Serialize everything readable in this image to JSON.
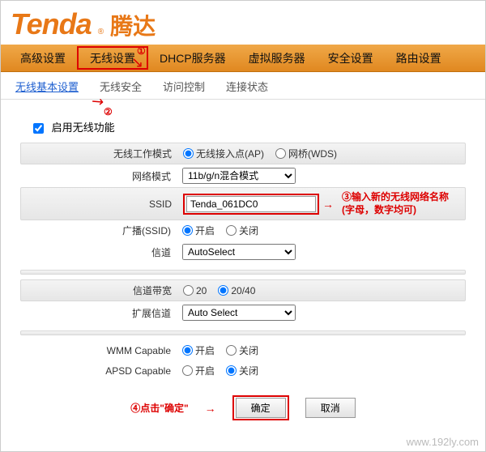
{
  "logo": {
    "brand": "Tenda",
    "reg": "®",
    "cn": "腾达"
  },
  "mainNav": [
    "高级设置",
    "无线设置",
    "DHCP服务器",
    "虚拟服务器",
    "安全设置",
    "路由设置"
  ],
  "subNav": [
    "无线基本设置",
    "无线安全",
    "访问控制",
    "连接状态"
  ],
  "enableLabel": "启用无线功能",
  "rows": {
    "workMode": {
      "label": "无线工作模式",
      "opt1": "无线接入点(AP)",
      "opt2": "网桥(WDS)"
    },
    "netMode": {
      "label": "网络模式",
      "value": "11b/g/n混合模式"
    },
    "ssid": {
      "label": "SSID",
      "value": "Tenda_061DC0"
    },
    "broadcast": {
      "label": "广播(SSID)",
      "opt1": "开启",
      "opt2": "关闭"
    },
    "channel": {
      "label": "信道",
      "value": "AutoSelect"
    },
    "bandwidth": {
      "label": "信道带宽",
      "opt1": "20",
      "opt2": "20/40"
    },
    "extChannel": {
      "label": "扩展信道",
      "value": "Auto Select"
    },
    "wmm": {
      "label": "WMM Capable",
      "opt1": "开启",
      "opt2": "关闭"
    },
    "apsd": {
      "label": "APSD Capable",
      "opt1": "开启",
      "opt2": "关闭"
    }
  },
  "buttons": {
    "ok": "确定",
    "cancel": "取消"
  },
  "annotations": {
    "n1": "①",
    "n2": "②",
    "n3a": "③输入新的无线网络名称",
    "n3b": "(字母，数字均可)",
    "n4": "④点击\"确定\"",
    "arrow": "→",
    "arrowDiag": "↘"
  },
  "watermark": "www.192ly.com"
}
